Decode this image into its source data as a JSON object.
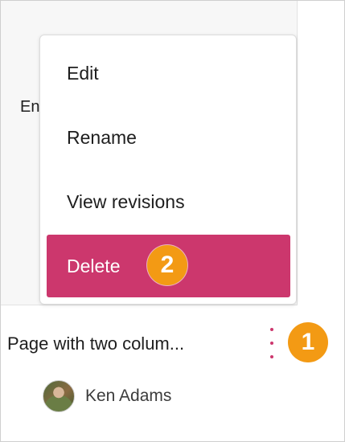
{
  "preview": {
    "text": "En"
  },
  "menu": {
    "items": [
      {
        "label": "Edit"
      },
      {
        "label": "Rename"
      },
      {
        "label": "View revisions"
      },
      {
        "label": "Delete"
      }
    ],
    "accent": "#cc376d"
  },
  "badges": {
    "step1": "1",
    "step2": "2",
    "color": "#f39a14"
  },
  "page": {
    "title": "Page with two colum..."
  },
  "author": {
    "name": "Ken Adams"
  },
  "icons": {
    "more": "kebab-vertical-icon",
    "avatar": "author-avatar"
  }
}
